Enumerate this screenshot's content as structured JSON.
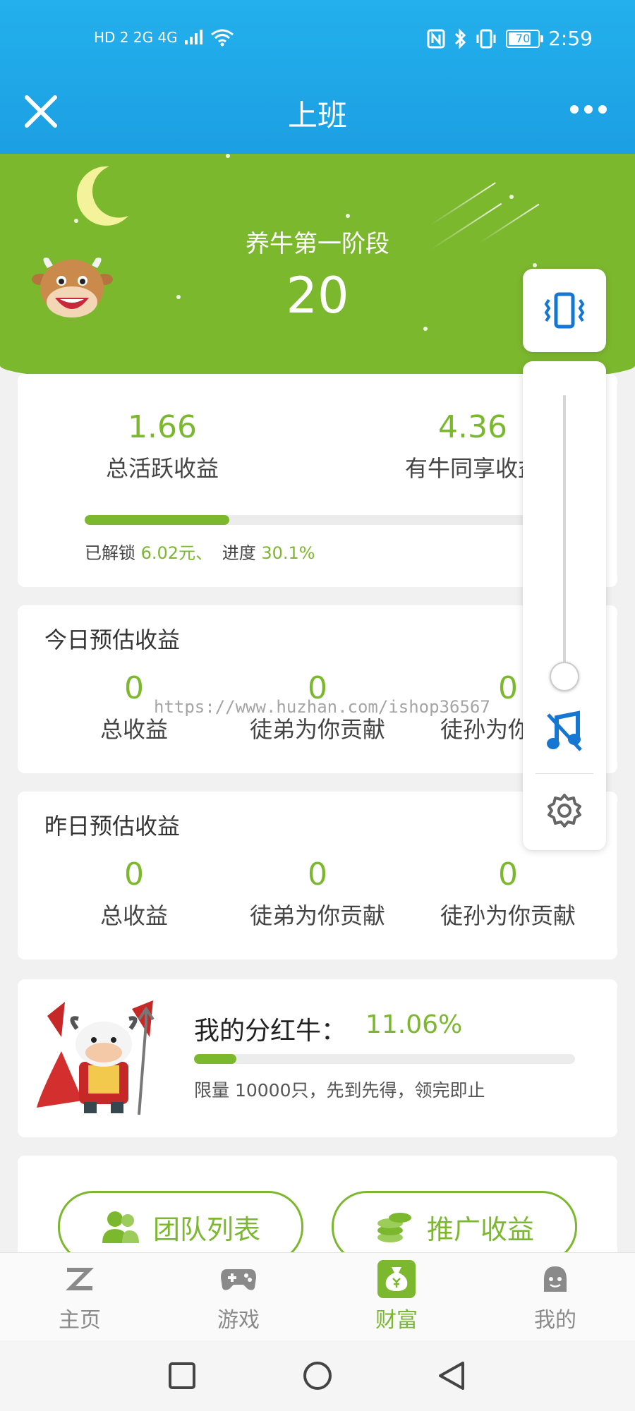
{
  "status_bar": {
    "left_text": "HD 2  2G  4G",
    "battery": "70",
    "time": "2:59"
  },
  "header": {
    "title": "上班"
  },
  "hero": {
    "stage_label": "养牛第一阶段",
    "stage_value": "20"
  },
  "earnings_card": {
    "total_active_value": "1.66",
    "total_active_label": "总活跃收益",
    "shared_value": "4.36",
    "shared_label": "有牛同享收益",
    "unlocked_prefix": "已解锁",
    "unlocked_value": "6.02元、",
    "progress_prefix": "进度",
    "progress_value": "30.1%",
    "progress_fraction": 0.301
  },
  "today": {
    "title": "今日预估收益",
    "items": [
      {
        "value": "0",
        "label": "总收益"
      },
      {
        "value": "0",
        "label": "徒弟为你贡献"
      },
      {
        "value": "0",
        "label": "徒孙为你贡献"
      }
    ]
  },
  "watermark": "https://www.huzhan.com/ishop36567",
  "yesterday": {
    "title": "昨日预估收益",
    "items": [
      {
        "value": "0",
        "label": "总收益"
      },
      {
        "value": "0",
        "label": "徒弟为你贡献"
      },
      {
        "value": "0",
        "label": "徒孙为你贡献"
      }
    ]
  },
  "dividend": {
    "label": "我的分红牛：",
    "value": "11.06%",
    "fraction": 0.1106,
    "note": "限量 10000只，先到先得，领完即止"
  },
  "actions": {
    "team_label": "团队列表",
    "promo_label": "推广收益"
  },
  "bottom_nav": {
    "items": [
      {
        "label": "主页"
      },
      {
        "label": "游戏"
      },
      {
        "label": "财富"
      },
      {
        "label": "我的"
      }
    ]
  },
  "colors": {
    "accent": "#7cb82e",
    "header_blue": "#1c9fe3",
    "icon_blue": "#1677d2"
  }
}
